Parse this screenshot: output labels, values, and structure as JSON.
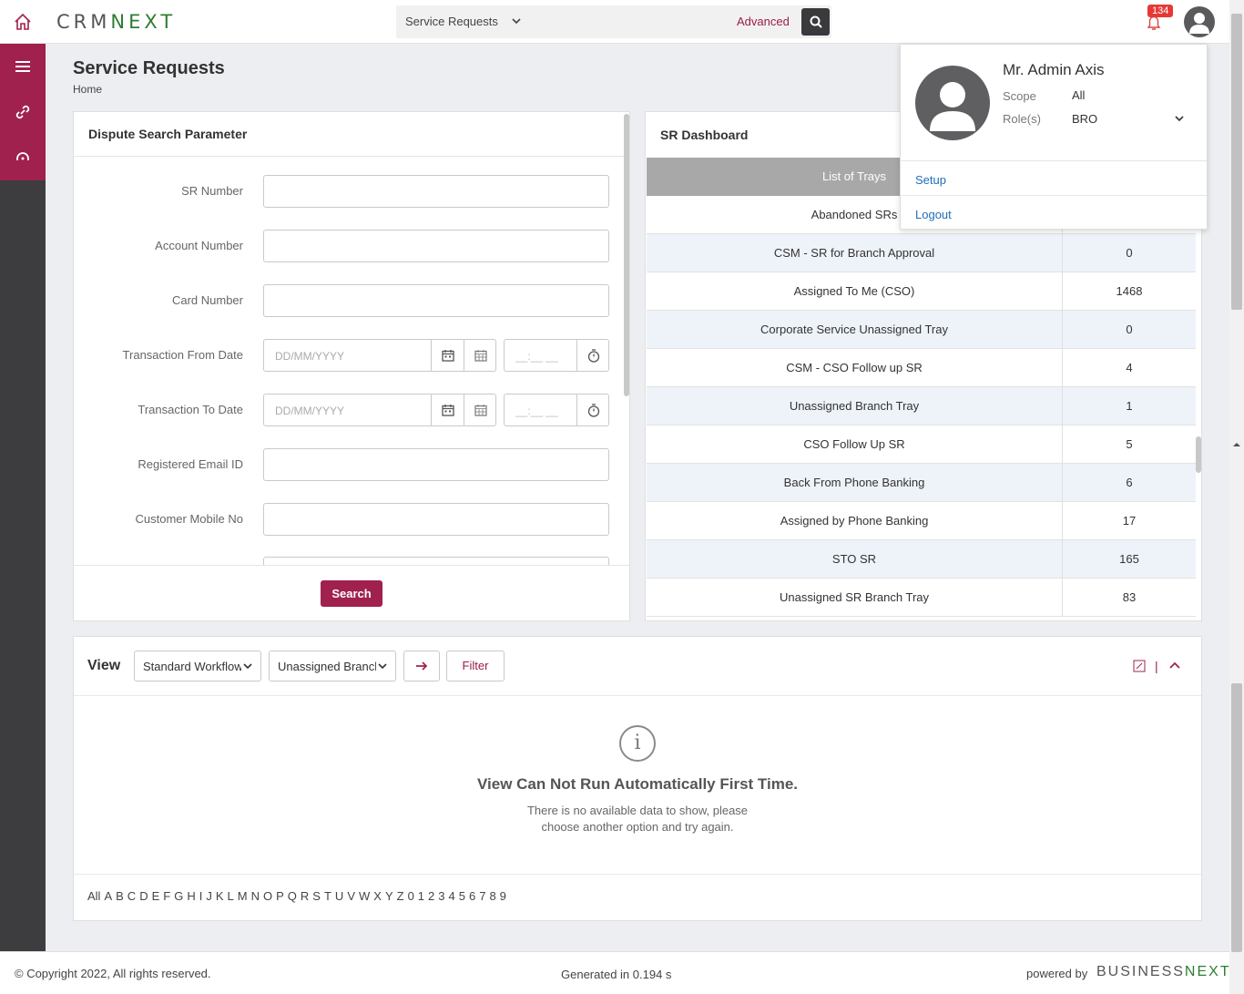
{
  "header": {
    "logo_left": "CRM",
    "logo_right": "NEXT",
    "search": {
      "module": "Service Requests",
      "placeholder": "",
      "advanced_label": "Advanced"
    },
    "notification_count": "134"
  },
  "page": {
    "title": "Service Requests",
    "breadcrumb": "Home"
  },
  "dispute": {
    "title": "Dispute Search Parameter",
    "fields": {
      "sr_number": "SR Number",
      "account_number": "Account Number",
      "card_number": "Card Number",
      "from_date": "Transaction From Date",
      "to_date": "Transaction To Date",
      "email": "Registered Email ID",
      "mobile": "Customer Mobile No"
    },
    "date_placeholder": "DD/MM/YYYY",
    "time_placeholder": "__:__ __",
    "search_label": "Search"
  },
  "dashboard": {
    "title": "SR Dashboard",
    "column_header": "List of Trays",
    "rows": [
      {
        "name": "Abandoned SRs",
        "count": ""
      },
      {
        "name": "CSM - SR for Branch Approval",
        "count": "0"
      },
      {
        "name": "Assigned To Me (CSO)",
        "count": "1468"
      },
      {
        "name": "Corporate Service Unassigned Tray",
        "count": "0"
      },
      {
        "name": "CSM - CSO Follow up SR",
        "count": "4"
      },
      {
        "name": "Unassigned Branch Tray",
        "count": "1"
      },
      {
        "name": "CSO Follow Up SR",
        "count": "5"
      },
      {
        "name": "Back From Phone Banking",
        "count": "6"
      },
      {
        "name": "Assigned by Phone Banking",
        "count": "17"
      },
      {
        "name": "STO SR",
        "count": "165"
      },
      {
        "name": "Unassigned SR Branch Tray",
        "count": "83"
      }
    ]
  },
  "view": {
    "label": "View",
    "workflow_select": "Standard Workflow",
    "tray_select": "Unassigned Branch",
    "filter_label": "Filter",
    "divider": "|",
    "empty_title": "View Can Not Run Automatically First Time.",
    "empty_line1": "There is no available data to show, please",
    "empty_line2": "choose another option and try again.",
    "info_glyph": "i",
    "alphabet": [
      "All",
      "A",
      "B",
      "C",
      "D",
      "E",
      "F",
      "G",
      "H",
      "I",
      "J",
      "K",
      "L",
      "M",
      "N",
      "O",
      "P",
      "Q",
      "R",
      "S",
      "T",
      "U",
      "V",
      "W",
      "X",
      "Y",
      "Z",
      "0",
      "1",
      "2",
      "3",
      "4",
      "5",
      "6",
      "7",
      "8",
      "9"
    ]
  },
  "footer": {
    "copyright": "© Copyright 2022, All rights reserved.",
    "generated": "Generated in 0.194 s",
    "powered_by": "powered by",
    "brand_left": "BUSINESS",
    "brand_right": "NEXT"
  },
  "user_menu": {
    "name": "Mr. Admin Axis",
    "scope_label": "Scope",
    "scope_value": "All",
    "roles_label": "Role(s)",
    "roles_value": "BRO",
    "setup_label": "Setup",
    "logout_label": "Logout"
  },
  "colors": {
    "brand": "#a0204e",
    "rail": "#3d3d40",
    "link": "#1f6fb8",
    "logo_accent": "#2e7d32"
  }
}
